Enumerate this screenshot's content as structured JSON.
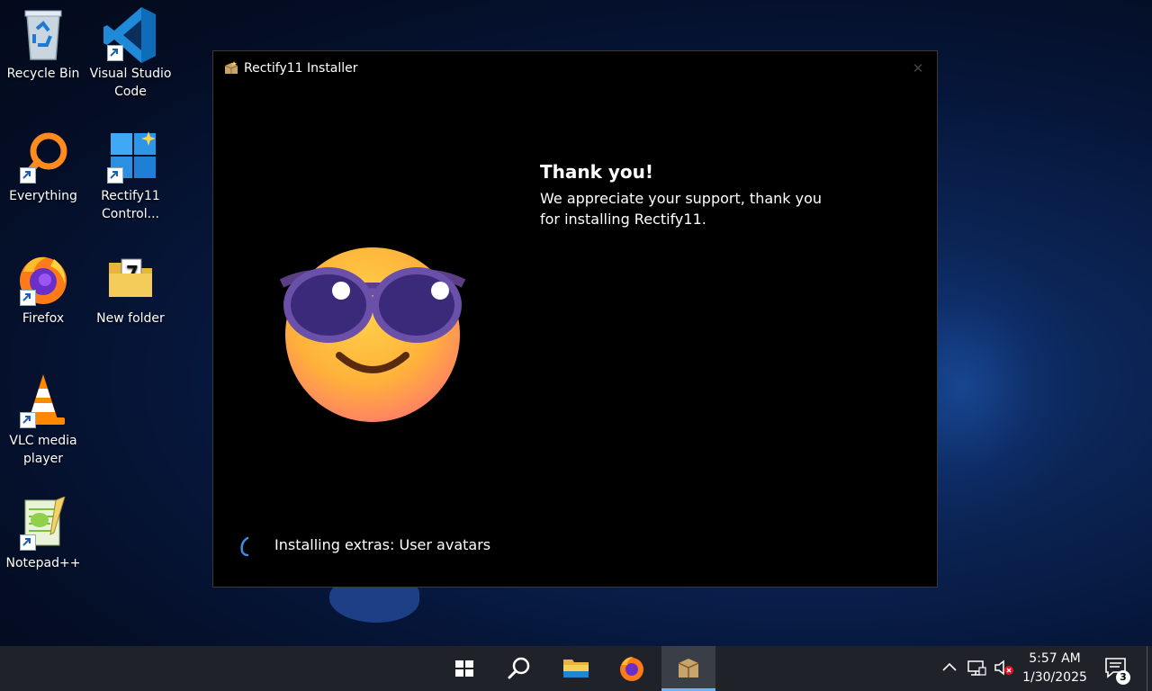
{
  "desktop": {
    "icons": [
      {
        "label": "Recycle Bin"
      },
      {
        "label": "Visual Studio Code"
      },
      {
        "label": "Everything"
      },
      {
        "label": "Rectify11 Control..."
      },
      {
        "label": "Firefox"
      },
      {
        "label": "New folder"
      },
      {
        "label": "VLC media player"
      },
      {
        "label": "Notepad++"
      }
    ]
  },
  "installer": {
    "title": "Rectify11 Installer",
    "close_glyph": "✕",
    "heading": "Thank you!",
    "message": "We appreciate your support, thank you for installing Rectify11.",
    "status": "Installing extras: User avatars"
  },
  "taskbar": {
    "buttons": [
      "start-icon",
      "search-icon",
      "file-explorer-icon",
      "firefox-icon",
      "rectify11-installer-icon"
    ],
    "active_button": "rectify11-installer-icon",
    "tray_icons": [
      "chevron-up-icon",
      "network-icon",
      "volume-muted-icon"
    ],
    "time": "5:57 AM",
    "date": "1/30/2025",
    "notification_count": "3"
  },
  "colors": {
    "accent": "#6cb3ff",
    "taskbar": "#1f2229",
    "window_bg": "#000000"
  }
}
